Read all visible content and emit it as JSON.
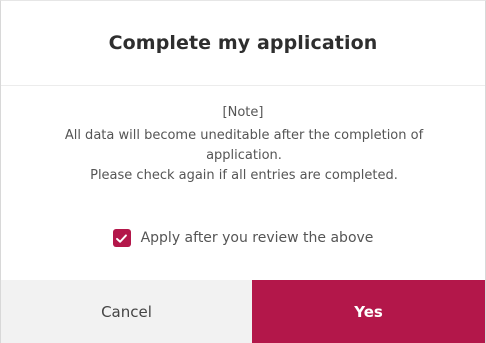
{
  "dialog": {
    "title": "Complete my application",
    "note_heading": "[Note]",
    "note_lines": [
      "All data will become uneditable after the completion of",
      "application.",
      "Please check again if all entries are completed."
    ],
    "confirm": {
      "label": "Apply after you review the above",
      "checked": true,
      "icon": "checkmark-icon"
    },
    "buttons": {
      "cancel_label": "Cancel",
      "yes_label": "Yes"
    }
  },
  "colors": {
    "accent": "#b3174a",
    "cancel_bg": "#f2f2f2",
    "text": "#555555",
    "title": "#2e2e2e"
  }
}
